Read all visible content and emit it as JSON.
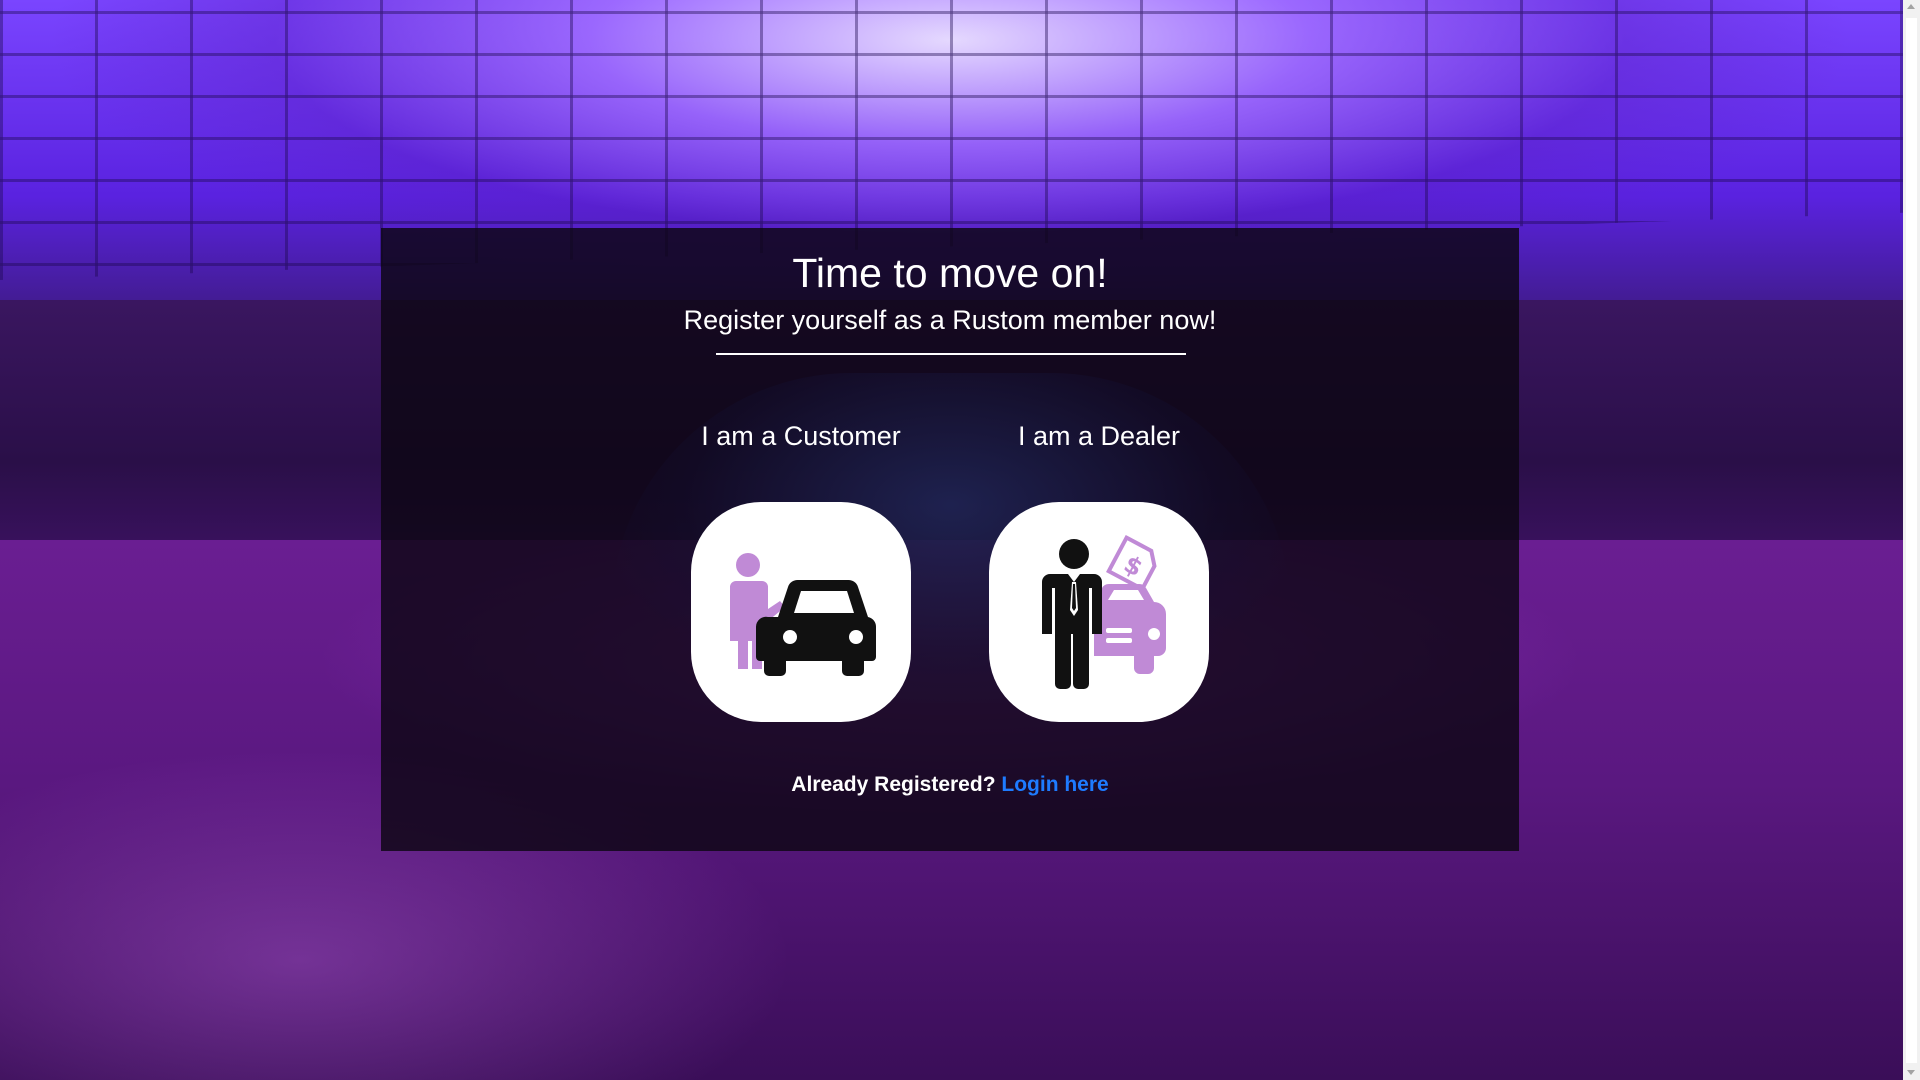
{
  "page": {
    "title": "Time to move on!",
    "subtitle": "Register yourself as a Rustom member now!"
  },
  "options": {
    "customer": {
      "label": "I am a Customer",
      "icon": "customer-car-icon"
    },
    "dealer": {
      "label": "I am a Dealer",
      "icon": "dealer-car-sale-icon"
    }
  },
  "login": {
    "prompt": "Already Registered?",
    "link_text": "Login here"
  },
  "colors": {
    "accent_purple": "#c08ad6",
    "link_blue": "#1e7bff",
    "panel_bg": "#0c0612"
  }
}
